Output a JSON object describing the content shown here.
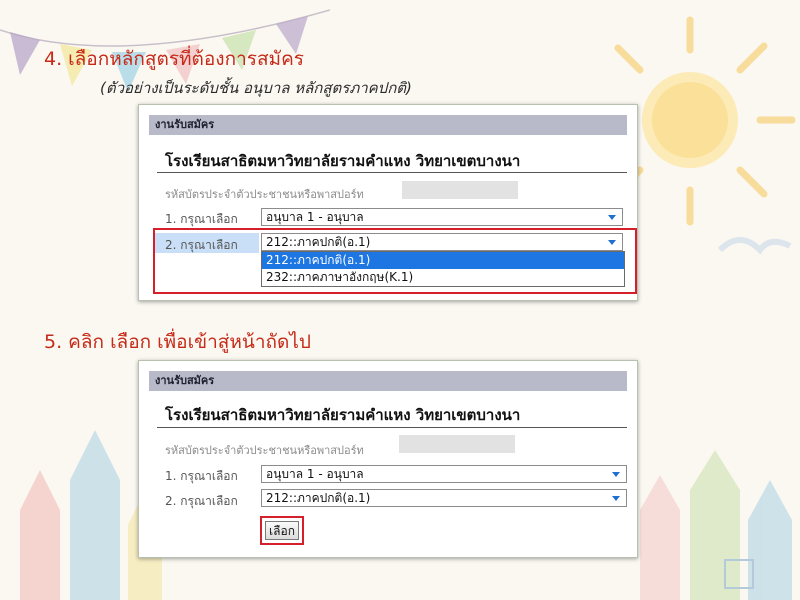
{
  "step4": {
    "title": "4. เลือกหลักสูตรที่ต้องการสมัคร",
    "subtitle": "(ตัวอย่างเป็นระดับชั้น อนุบาล หลักสูตรภาคปกติ)"
  },
  "step5": {
    "title": "5. คลิก เลือก เพื่อเข้าสู่หน้าถัดไป"
  },
  "panel1": {
    "header": "งานรับสมัคร",
    "school": "โรงเรียนสาธิตมหาวิทยาลัยรามคำแหง วิทยาเขตบางนา",
    "id_label": "รหัสบัตรประจำตัวประชาชนหรือพาสปอร์ท",
    "row1_label": "1. กรุณาเลือก",
    "row1_value": "อนุบาล 1 - อนุบาล",
    "row2_label": "2. กรุณาเลือก",
    "row2_value": "212::ภาคปกติ(อ.1)",
    "options": [
      "212::ภาคปกติ(อ.1)",
      "232::ภาคภาษาอังกฤษ(K.1)"
    ]
  },
  "panel2": {
    "header": "งานรับสมัคร",
    "school": "โรงเรียนสาธิตมหาวิทยาลัยรามคำแหง วิทยาเขตบางนา",
    "id_label": "รหัสบัตรประจำตัวประชาชนหรือพาสปอร์ท",
    "row1_label": "1. กรุณาเลือก",
    "row1_value": "อนุบาล 1 - อนุบาล",
    "row2_label": "2. กรุณาเลือก",
    "row2_value": "212::ภาคปกติ(อ.1)",
    "button_label": "เลือก"
  },
  "colors": {
    "step_title": "#c62a18",
    "panel_header_bg": "#b8bac9",
    "highlight_red": "#d4202a",
    "selected_option": "#1e76e3",
    "dropdown_arrow": "#1f6fd1"
  },
  "icons": {
    "dropdown": "chevron-down-icon",
    "decor_sun": "sun-illustration",
    "decor_bunting": "bunting-flags",
    "decor_pencils": "pencil-houses"
  }
}
